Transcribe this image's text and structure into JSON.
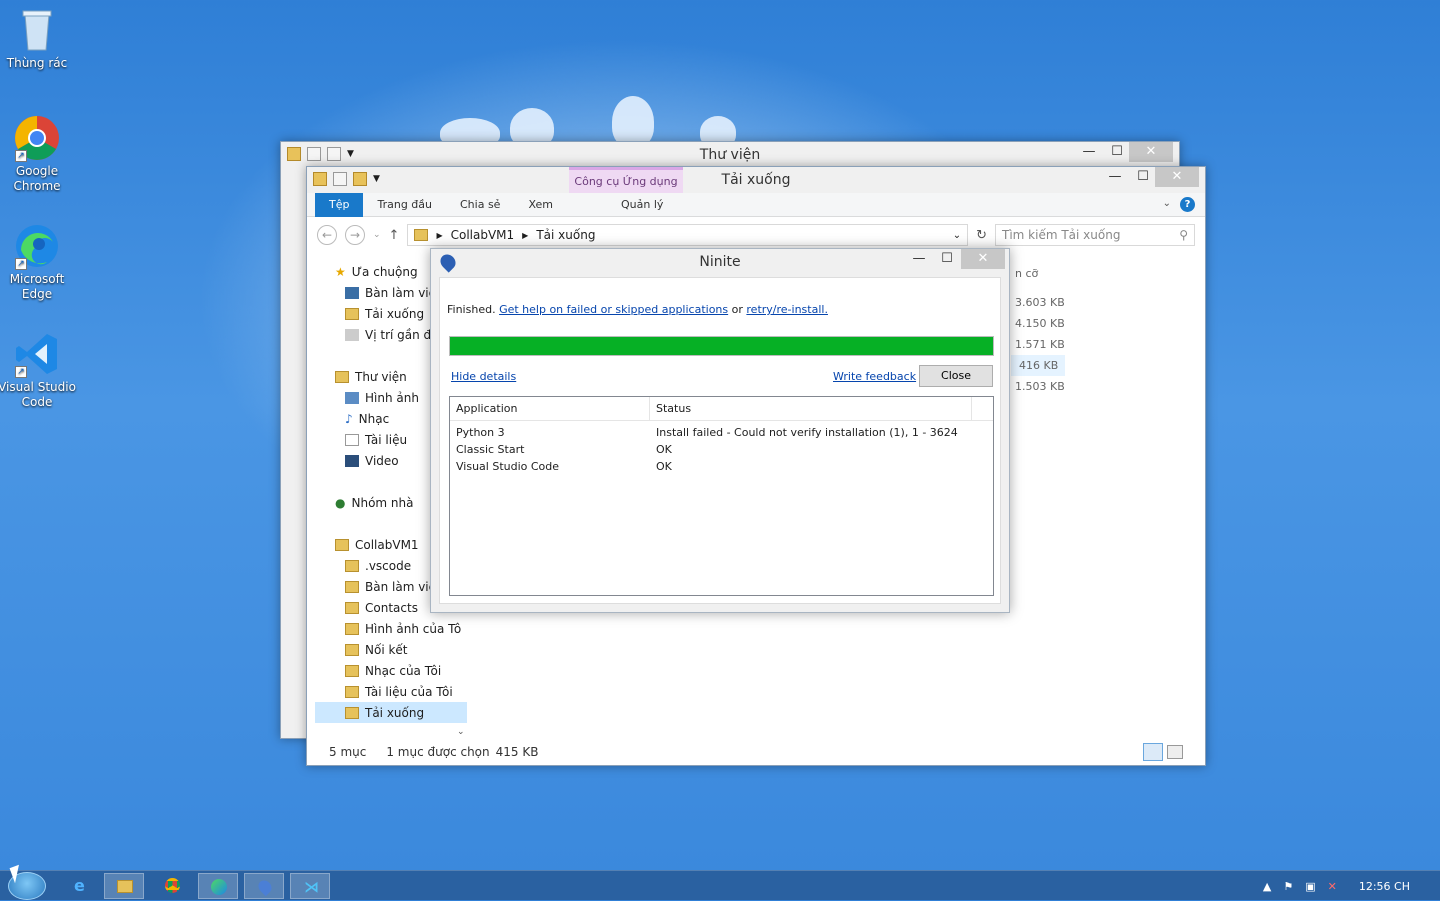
{
  "desktop": {
    "icons": [
      {
        "label": "Thùng rác"
      },
      {
        "label": "Google Chrome"
      },
      {
        "label": "Microsoft Edge"
      },
      {
        "label": "Visual Studio Code"
      }
    ]
  },
  "library_window": {
    "title": "Thư viện"
  },
  "explorer": {
    "title": "Tải xuống",
    "context_tab_group": "Công cụ Ứng dụng",
    "tabs": [
      {
        "label": "Tệp"
      },
      {
        "label": "Trang đầu"
      },
      {
        "label": "Chia sẻ"
      },
      {
        "label": "Xem"
      },
      {
        "label": "Quản lý"
      }
    ],
    "breadcrumb": [
      "CollabVM1",
      "Tải xuống"
    ],
    "search_placeholder": "Tìm kiếm Tải xuống",
    "size_header": "n cỡ",
    "sizes": [
      "3.603 KB",
      "4.150 KB",
      "1.571 KB",
      "416 KB",
      "1.503 KB"
    ],
    "nav": {
      "favorites": "Ưa chuộng",
      "favorites_items": [
        "Bàn làm việ",
        "Tải xuống",
        "Vị trí gần đâ"
      ],
      "libraries": "Thư viện",
      "libraries_items": [
        "Hình ảnh",
        "Nhạc",
        "Tài liệu",
        "Video"
      ],
      "homegroup": "Nhóm nhà",
      "user": "CollabVM1",
      "user_items": [
        ".vscode",
        "Bàn làm việ",
        "Contacts",
        "Hình ảnh của Tô",
        "Nối kết",
        "Nhạc của Tôi",
        "Tài liệu của Tôi",
        "Tải xuống"
      ]
    },
    "status": {
      "count": "5 mục",
      "selection": "1 mục được chọn",
      "size": "415 KB"
    }
  },
  "ninite": {
    "title": "Ninite",
    "finished": "Finished.",
    "help_link": "Get help on failed or skipped applications",
    "or": "or",
    "retry_link": "retry/re-install.",
    "progress": 1.0,
    "hide_details": "Hide details",
    "write_feedback": "Write feedback",
    "close_button": "Close",
    "columns": [
      "Application",
      "Status"
    ],
    "rows": [
      {
        "app": "Python 3",
        "status": "Install failed - Could not verify installation (1), 1 - 3624"
      },
      {
        "app": "Classic Start",
        "status": "OK"
      },
      {
        "app": "Visual Studio Code",
        "status": "OK"
      }
    ]
  },
  "taskbar": {
    "clock": "12:56 CH"
  }
}
